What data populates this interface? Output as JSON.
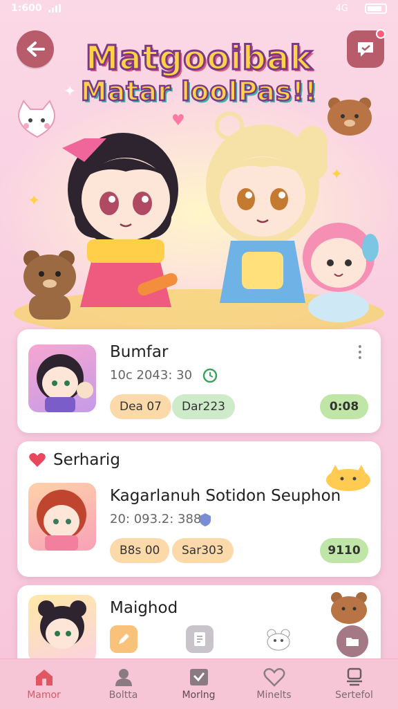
{
  "status_bar": {
    "time": "1:600",
    "network": "4G"
  },
  "header": {
    "title_line1": "Matgooibak",
    "title_line2": "Matar loolPas!!",
    "back_icon": "arrow-left-icon",
    "chat_icon": "chat-bubble-icon"
  },
  "colors": {
    "button_bg": "#b85b6a",
    "title_fill": "#ffd24a",
    "title_outline": "#7b3a86",
    "active_tab": "#e25663",
    "action_pill": "#bfe5a7",
    "orange_pill": "#fbd9a9",
    "green_pill": "#cdeac9"
  },
  "cards": [
    {
      "title": "Bumfar",
      "meta": "10c 2043: 30",
      "tag1": "Dea 07",
      "tag2": "Dar223",
      "action": "0:08"
    },
    {
      "section_label": "Serharig",
      "title": "Kagarlanuh Sotidon Seuphon",
      "meta": "20: 093.2: 388",
      "tag1": "B8s 00",
      "tag2": "Sar303",
      "action": "9110"
    },
    {
      "title": "Maighod"
    }
  ],
  "quick_actions": [
    "pencil-icon",
    "document-icon",
    "bear-sticker-icon",
    "folder-icon"
  ],
  "tabs": [
    {
      "label": "Mamor",
      "icon": "home-icon",
      "active": true
    },
    {
      "label": "Boltta",
      "icon": "person-icon",
      "active": false
    },
    {
      "label": "Morlng",
      "icon": "check-box-icon",
      "active": false
    },
    {
      "label": "Minelts",
      "icon": "heart-icon",
      "active": false
    },
    {
      "label": "Sertefol",
      "icon": "cup-icon",
      "active": false
    }
  ]
}
